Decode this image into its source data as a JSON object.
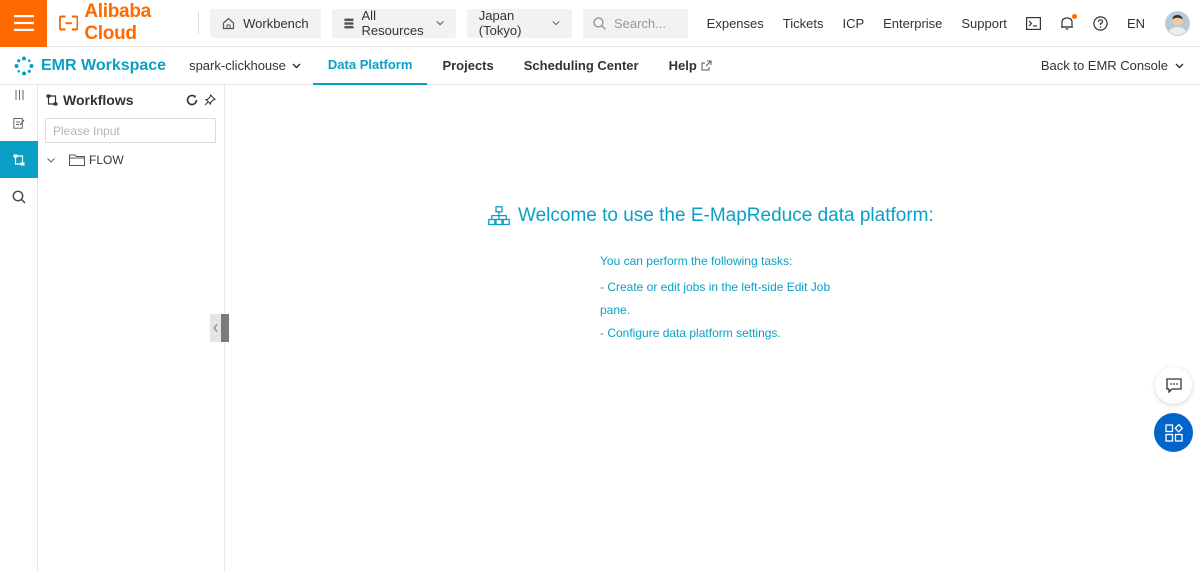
{
  "topbar": {
    "brand": "Alibaba Cloud",
    "workbench_label": "Workbench",
    "resources_label": "All Resources",
    "region_label": "Japan (Tokyo)",
    "search_placeholder": "Search...",
    "links": [
      "Expenses",
      "Tickets",
      "ICP",
      "Enterprise",
      "Support"
    ],
    "language": "EN"
  },
  "subbar": {
    "app_title": "EMR Workspace",
    "project": "spark-clickhouse",
    "tabs": [
      {
        "label": "Data Platform",
        "active": true
      },
      {
        "label": "Projects",
        "active": false
      },
      {
        "label": "Scheduling Center",
        "active": false
      },
      {
        "label": "Help",
        "active": false
      }
    ],
    "back_label": "Back to EMR Console"
  },
  "panel": {
    "title": "Workflows",
    "search_placeholder": "Please Input",
    "tree": [
      {
        "label": "FLOW",
        "type": "folder",
        "expanded": false
      }
    ]
  },
  "main": {
    "welcome_title": "Welcome to use the E-MapReduce data platform:",
    "intro": "You can perform the following tasks:",
    "tasks": [
      "- Create or edit jobs in the left-side Edit Job pane.",
      "- Configure data platform settings."
    ]
  },
  "colors": {
    "brand_orange": "#ff6a00",
    "accent_teal": "#0aa0c5",
    "fab_blue": "#0064c8"
  }
}
